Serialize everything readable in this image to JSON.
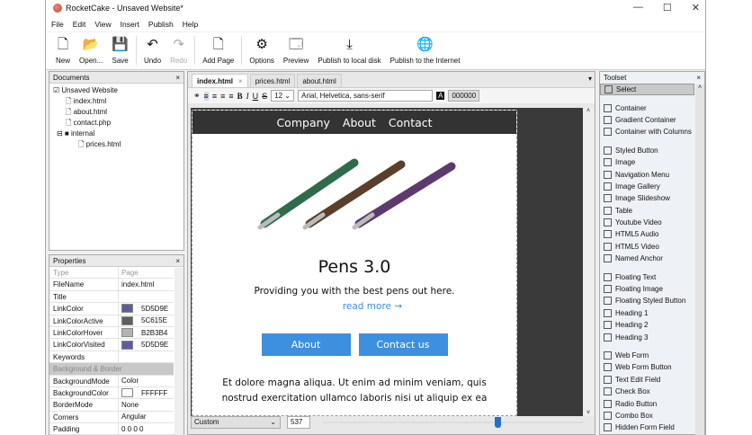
{
  "window": {
    "title": "RocketCake - Unsaved Website*",
    "controls": [
      "—",
      "☐",
      "✕"
    ]
  },
  "menu": [
    "File",
    "Edit",
    "View",
    "Insert",
    "Publish",
    "Help"
  ],
  "toolbar": [
    {
      "label": "New",
      "icon": "🗋"
    },
    {
      "label": "Open...",
      "icon": "📂"
    },
    {
      "label": "Save",
      "icon": "💾"
    },
    {
      "sep": true
    },
    {
      "label": "Undo",
      "icon": "↶"
    },
    {
      "label": "Redo",
      "icon": "↷",
      "disabled": true
    },
    {
      "sep": true
    },
    {
      "label": "Add Page",
      "icon": "🗋"
    },
    {
      "sep": true
    },
    {
      "label": "Options",
      "icon": "⚙"
    },
    {
      "label": "Preview",
      "icon": "🗔"
    },
    {
      "label": "Publish to local disk",
      "icon": "⤓"
    },
    {
      "label": "Publish to the Internet",
      "icon": "🌐"
    }
  ],
  "documents": {
    "title": "Documents",
    "close": "×",
    "root": "Unsaved Website",
    "files": [
      "index.html",
      "about.html",
      "contact.php"
    ],
    "folder": "internal",
    "subfiles": [
      "prices.html"
    ]
  },
  "properties": {
    "title": "Properties",
    "close": "×",
    "rows": [
      {
        "k": "Type",
        "v": "Page",
        "muted": true
      },
      {
        "k": "FileName",
        "v": "index.html"
      },
      {
        "k": "Title",
        "v": ""
      },
      {
        "k": "LinkColor",
        "v": "5D5D9E",
        "color": "#5d5d9e"
      },
      {
        "k": "LinkColorActive",
        "v": "5C615E",
        "color": "#5c615e"
      },
      {
        "k": "LinkColorHover",
        "v": "B2B3B4",
        "color": "#b2b3b4"
      },
      {
        "k": "LinkColorVisited",
        "v": "5D5D9E",
        "color": "#5d5d9e"
      },
      {
        "k": "Keywords",
        "v": ""
      },
      {
        "section": "Background & Border"
      },
      {
        "k": "BackgroundMode",
        "v": "Color"
      },
      {
        "k": "BackgroundColor",
        "v": "FFFFFF",
        "color": "#ffffff"
      },
      {
        "k": "BorderMode",
        "v": "None"
      },
      {
        "k": "Corners",
        "v": "Angular"
      },
      {
        "k": "Padding",
        "v": "0 0 0 0"
      }
    ]
  },
  "tabs": [
    {
      "label": "index.html",
      "active": true,
      "close": "×"
    },
    {
      "label": "prices.html"
    },
    {
      "label": "about.html"
    }
  ],
  "format": {
    "bold": "B",
    "italic": "I",
    "underline": "U",
    "strike": "S",
    "size": "12",
    "font": "Arial, Helvetica, sans-serif",
    "color_label": "A",
    "color": "000000"
  },
  "page": {
    "nav": [
      "Company",
      "About",
      "Contact"
    ],
    "heading": "Pens 3.0",
    "subtitle": "Providing you with the best pens out here.",
    "link": "read more →",
    "buttons": [
      "About",
      "Contact us"
    ],
    "para1": "Et dolore magna aliqua. Ut enim ad minim veniam, quis",
    "para2": "nostrud exercitation ullamco laboris nisi ut aliquip ex ea",
    "button_color": "#3d8fdf"
  },
  "bottom": {
    "preset": "Custom",
    "width": "537",
    "slider_percent": 66
  },
  "toolset": {
    "title": "Toolset",
    "close": "×",
    "groups": [
      [
        "Select"
      ],
      [
        "Container",
        "Gradient Container",
        "Container with Columns"
      ],
      [
        "Styled Button",
        "Image",
        "Navigation Menu",
        "Image Gallery",
        "Image Slideshow",
        "Table",
        "Youtube Video",
        "HTML5 Audio",
        "HTML5 Video",
        "Named Anchor"
      ],
      [
        "Floating Text",
        "Floating Image",
        "Floating Styled Button",
        "Heading 1",
        "Heading 2",
        "Heading 3"
      ],
      [
        "Web Form",
        "Web Form Button",
        "Text Edit Field",
        "Check Box",
        "Radio Button",
        "Combo Box",
        "Hidden Form Field"
      ]
    ]
  }
}
